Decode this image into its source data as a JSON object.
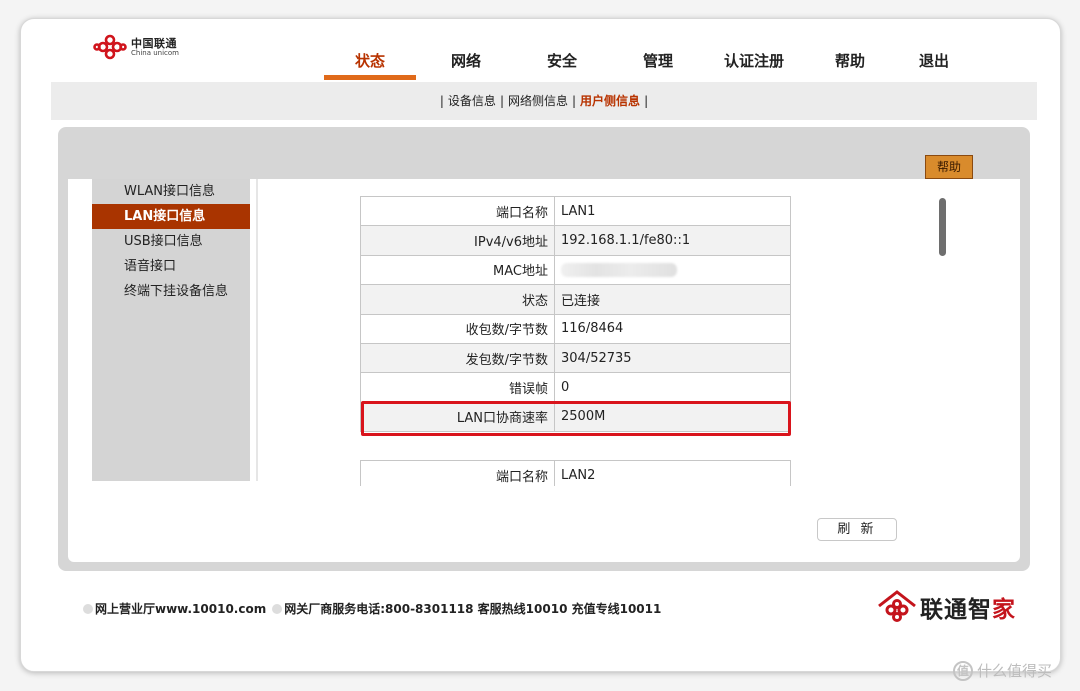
{
  "header": {
    "logo_cn": "中国联通",
    "logo_en": "China unicom"
  },
  "topnav": [
    {
      "label": "状态",
      "name": "nav-status",
      "active": true
    },
    {
      "label": "网络",
      "name": "nav-network",
      "active": false
    },
    {
      "label": "安全",
      "name": "nav-security",
      "active": false
    },
    {
      "label": "管理",
      "name": "nav-management",
      "active": false
    },
    {
      "label": "认证注册",
      "name": "nav-auth-register",
      "active": false
    },
    {
      "label": "帮助",
      "name": "nav-help",
      "active": false
    },
    {
      "label": "退出",
      "name": "nav-logout",
      "active": false
    }
  ],
  "subnav": {
    "items": [
      "设备信息",
      "网络侧信息",
      "用户侧信息"
    ],
    "active_index": 2
  },
  "help_button": "帮助",
  "sidebar": {
    "items": [
      "WLAN接口信息",
      "LAN接口信息",
      "USB接口信息",
      "语音接口",
      "终端下挂设备信息"
    ],
    "active_index": 1
  },
  "lan1": {
    "rows": [
      {
        "label": "端口名称",
        "value": "LAN1"
      },
      {
        "label": "IPv4/v6地址",
        "value": "192.168.1.1/fe80::1"
      },
      {
        "label": "MAC地址",
        "value": ""
      },
      {
        "label": "状态",
        "value": "已连接"
      },
      {
        "label": "收包数/字节数",
        "value": "116/8464"
      },
      {
        "label": "发包数/字节数",
        "value": "304/52735"
      },
      {
        "label": "错误帧",
        "value": "0"
      },
      {
        "label": "LAN口协商速率",
        "value": "2500M"
      }
    ],
    "highlighted_row": 7
  },
  "lan2": {
    "rows": [
      {
        "label": "端口名称",
        "value": "LAN2"
      }
    ]
  },
  "refresh_button": "刷 新",
  "footer": {
    "portal": "网上营业厅www.10010.com",
    "hotline": "网关厂商服务电话:800-8301118 客服热线10010 充值专线10011"
  },
  "brand": {
    "text_part1": "联通智",
    "text_part2": "家"
  },
  "watermark": "什么值得买",
  "colors": {
    "accent": "#b83300",
    "active_sidebar": "#a93400",
    "highlight_border": "#d9141c",
    "help_button": "#d98b2c"
  }
}
